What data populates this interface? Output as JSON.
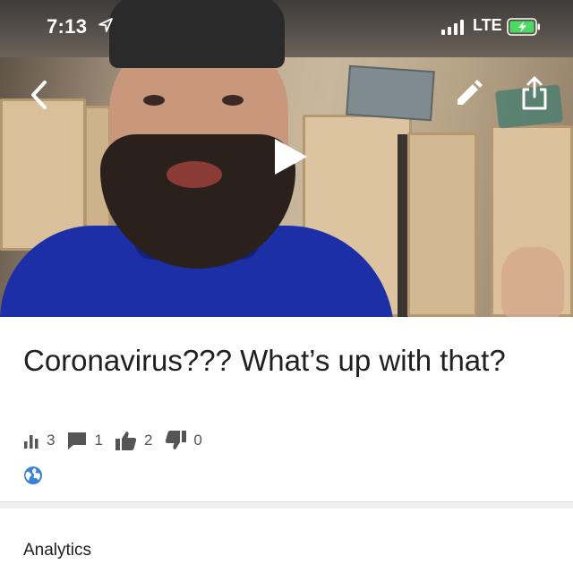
{
  "status_bar": {
    "time": "7:13",
    "network": "LTE",
    "icons": [
      "location-arrow-icon",
      "signal-bars-icon",
      "battery-charging-icon"
    ]
  },
  "video": {
    "controls": [
      "back-icon",
      "edit-icon",
      "share-icon",
      "play-icon"
    ]
  },
  "details": {
    "title": "Coronavirus??? What’s up with that?",
    "stats": {
      "views": "3",
      "comments": "1",
      "likes": "2",
      "dislikes": "0"
    },
    "visibility_icon": "globe-icon"
  },
  "analytics_label": "Analytics",
  "colors": {
    "hoodie": "#1c2fa7",
    "battery": "#4cd964",
    "globe": "#3b82d6",
    "stat_icon": "#555555",
    "title_text": "#202020"
  }
}
